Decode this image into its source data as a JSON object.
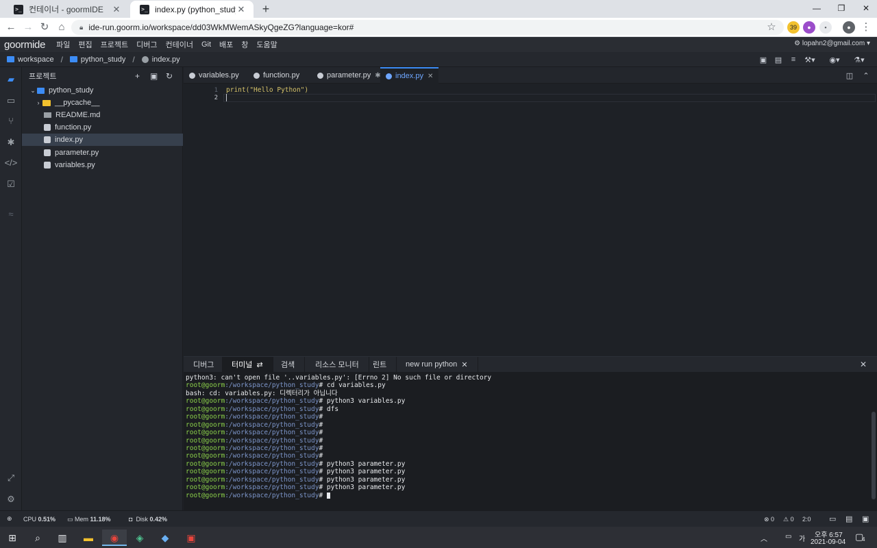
{
  "browser": {
    "tabs": [
      {
        "title": "컨테이너 - goormIDE"
      },
      {
        "title": "index.py (python_study) - goorm"
      }
    ],
    "url": "ide-run.goorm.io/workspace/dd03WkMWemASkyQgeZG?language=kor#",
    "ext_badge": "39"
  },
  "ide": {
    "logo": "goormide",
    "menu": [
      "파일",
      "편집",
      "프로젝트",
      "디버그",
      "컨테이너",
      "Git",
      "배포",
      "창",
      "도움말"
    ],
    "account": "lopahn2@gmail.com",
    "breadcrumb": [
      "workspace",
      "python_study",
      "index.py"
    ]
  },
  "explorer": {
    "title": "프로젝트",
    "project": "python_study",
    "items": [
      {
        "name": "__pycache__",
        "kind": "folder"
      },
      {
        "name": "README.md",
        "kind": "md"
      },
      {
        "name": "function.py",
        "kind": "py"
      },
      {
        "name": "index.py",
        "kind": "py",
        "selected": true
      },
      {
        "name": "parameter.py",
        "kind": "py"
      },
      {
        "name": "variables.py",
        "kind": "py"
      }
    ]
  },
  "editor": {
    "tabs": [
      {
        "label": "variables.py",
        "mark": ""
      },
      {
        "label": "function.py",
        "mark": ""
      },
      {
        "label": "parameter.py",
        "mark": "✱"
      },
      {
        "label": "index.py",
        "mark": "✕",
        "active": true
      }
    ],
    "lines": [
      {
        "num": "1",
        "text": "print(\"Hello Python\")"
      },
      {
        "num": "2",
        "text": ""
      }
    ]
  },
  "panel": {
    "tabs": [
      "디버그",
      "터미널",
      "검색",
      "리소스 모니터",
      "린트",
      "new run python"
    ],
    "terminal": [
      {
        "plain": "python3: can't open file '..variables.py': [Errno 2] No such file or directory"
      },
      {
        "user": "root@goorm",
        "path": ":/workspace/python_study",
        "cmd": "# cd variables.py"
      },
      {
        "plain": "bash: cd: variables.py: 디렉터리가 아닙니다"
      },
      {
        "user": "root@goorm",
        "path": ":/workspace/python_study",
        "cmd": "# python3 variables.py"
      },
      {
        "user": "root@goorm",
        "path": ":/workspace/python_study",
        "cmd": "# dfs"
      },
      {
        "user": "root@goorm",
        "path": ":/workspace/python_study",
        "cmd": "#"
      },
      {
        "user": "root@goorm",
        "path": ":/workspace/python_study",
        "cmd": "#"
      },
      {
        "user": "root@goorm",
        "path": ":/workspace/python_study",
        "cmd": "#"
      },
      {
        "user": "root@goorm",
        "path": ":/workspace/python_study",
        "cmd": "#"
      },
      {
        "user": "root@goorm",
        "path": ":/workspace/python_study",
        "cmd": "#"
      },
      {
        "user": "root@goorm",
        "path": ":/workspace/python_study",
        "cmd": "#"
      },
      {
        "user": "root@goorm",
        "path": ":/workspace/python_study",
        "cmd": "# python3 parameter.py"
      },
      {
        "user": "root@goorm",
        "path": ":/workspace/python_study",
        "cmd": "# python3 parameter.py"
      },
      {
        "user": "root@goorm",
        "path": ":/workspace/python_study",
        "cmd": "# python3 parameter.py"
      },
      {
        "user": "root@goorm",
        "path": ":/workspace/python_study",
        "cmd": "# python3 parameter.py"
      },
      {
        "user": "root@goorm",
        "path": ":/workspace/python_study",
        "cmd": "# "
      }
    ]
  },
  "status": {
    "cpu_label": "CPU",
    "cpu": "0.51%",
    "mem_label": "Mem",
    "mem": "11.18%",
    "disk_label": "Disk",
    "disk": "0.42%",
    "errors": "0",
    "warnings": "0",
    "cursor": "2:0"
  },
  "taskbar": {
    "ime": "가",
    "time": "오후 6:57",
    "date": "2021-09-04",
    "notif": "4"
  }
}
